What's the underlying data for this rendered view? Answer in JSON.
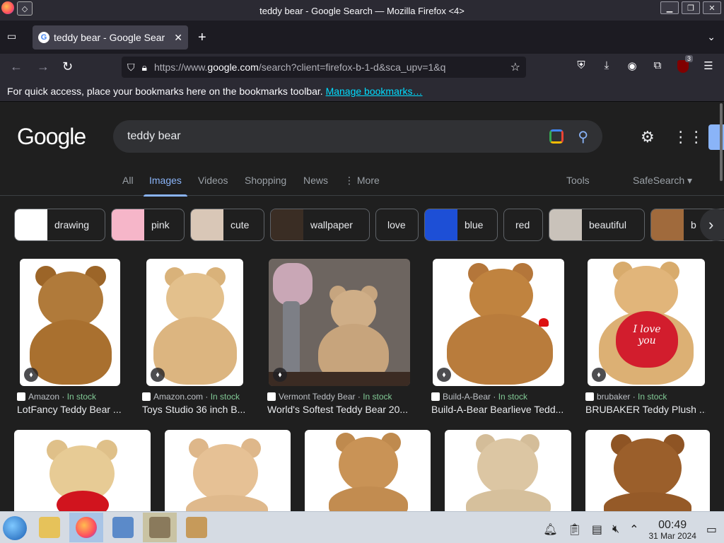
{
  "window": {
    "title": "teddy bear - Google Search — Mozilla Firefox <4>",
    "minimize": "▁",
    "maximize": "❐",
    "close": "✕"
  },
  "tab": {
    "title": "teddy bear - Google Sear",
    "favicon": "G",
    "close": "✕",
    "new_tab": "+"
  },
  "nav": {
    "back": "←",
    "forward": "→",
    "reload": "↻",
    "url_prefix": "https://www.",
    "url_domain": "google.com",
    "url_rest": "/search?client=firefox-b-1-d&sca_upv=1&q",
    "extension_badge": "3"
  },
  "bookmarks_bar": {
    "message": "For quick access, place your bookmarks here on the bookmarks toolbar.",
    "link": "Manage bookmarks…"
  },
  "google": {
    "logo": "Google",
    "query": "teddy bear",
    "tabs": [
      "All",
      "Images",
      "Videos",
      "Shopping",
      "News",
      "More"
    ],
    "active_tab": "Images",
    "tools": "Tools",
    "safesearch": "SafeSearch",
    "chips": [
      "drawing",
      "pink",
      "cute",
      "wallpaper",
      "love",
      "blue",
      "red",
      "beautiful",
      "b"
    ],
    "results_row1": [
      {
        "source": "Amazon",
        "stock": "In stock",
        "title": "LotFancy Teddy Bear ..."
      },
      {
        "source": "Amazon.com",
        "stock": "In stock",
        "title": "Toys Studio 36 inch B..."
      },
      {
        "source": "Vermont Teddy Bear",
        "stock": "In stock",
        "title": "World's Softest Teddy Bear 20..."
      },
      {
        "source": "Build-A-Bear",
        "stock": "In stock",
        "title": "Build-A-Bear Bearlieve Tedd..."
      },
      {
        "source": "brubaker",
        "stock": "In stock",
        "title": "BRUBAKER Teddy Plush ..."
      }
    ],
    "heart_text_1": "I love",
    "heart_text_2": "you"
  },
  "taskbar": {
    "time": "00:49",
    "date": "31 Mar 2024"
  },
  "colors": {
    "accent": "#8ab4f8",
    "in_stock": "#81c995",
    "page_bg": "#1f1f1f",
    "chrome_bg": "#2b2a33"
  }
}
